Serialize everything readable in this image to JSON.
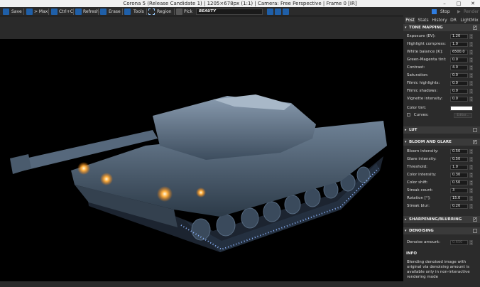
{
  "window": {
    "title": "Corona 5 (Release Candidate 1) | 1205×678px (1:1) | Camera: Free Perspective | Frame 0 [IR]",
    "minimize": "–",
    "maximize": "□",
    "close": "✕"
  },
  "toolbar": {
    "save": "Save",
    "max": "> Max",
    "ctrl_c": "Ctrl+C",
    "refresh": "Refresh",
    "erase": "Erase",
    "tools": "Tools",
    "region": "Region",
    "pick": "Pick",
    "pass_value": "BEAUTY"
  },
  "panel": {
    "stop": "Stop",
    "render": "Render",
    "tabs": [
      "Post",
      "Stats",
      "History",
      "DR",
      "LightMix"
    ],
    "tone_mapping": {
      "title": "TONE MAPPING",
      "rows": [
        {
          "label": "Exposure (EV):",
          "value": "1.20"
        },
        {
          "label": "Highlight compress:",
          "value": "1.0"
        },
        {
          "label": "White balance [K]:",
          "value": "6500.0"
        },
        {
          "label": "Green-Magenta tint:",
          "value": "0.0"
        },
        {
          "label": "Contrast:",
          "value": "4.0"
        },
        {
          "label": "Saturation:",
          "value": "0.0"
        },
        {
          "label": "Filmic highlights:",
          "value": "0.0"
        },
        {
          "label": "Filmic shadows:",
          "value": "0.0"
        },
        {
          "label": "Vignette intensity:",
          "value": "0.0"
        }
      ],
      "color_tint": "Color tint:",
      "curves": "Curves:",
      "editor": "Editor..."
    },
    "lut": {
      "title": "LUT"
    },
    "bloom_glare": {
      "title": "BLOOM AND GLARE",
      "rows": [
        {
          "label": "Bloom intensity:",
          "value": "0.50"
        },
        {
          "label": "Glare intensity:",
          "value": "0.50"
        },
        {
          "label": "Threshold:",
          "value": "1.0"
        },
        {
          "label": "Color intensity:",
          "value": "0.30"
        },
        {
          "label": "Color shift:",
          "value": "0.50"
        },
        {
          "label": "Streak count:",
          "value": "3"
        },
        {
          "label": "Rotation [°]:",
          "value": "15.0"
        },
        {
          "label": "Streak blur:",
          "value": "0.20"
        }
      ]
    },
    "sharpening": {
      "title": "SHARPENING/BLURRING"
    },
    "denoising": {
      "title": "DENOISING",
      "label": "Denoise amount:",
      "value": "0.650"
    },
    "info": {
      "title": "INFO",
      "text": "Blending denoised image with original via denoising amount is available only in non-interactive rendering mode"
    }
  }
}
